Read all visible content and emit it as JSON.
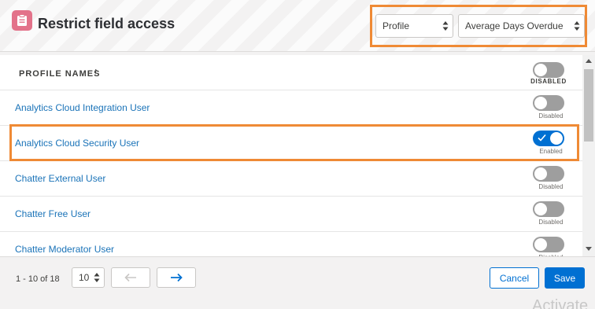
{
  "modal": {
    "title": "Restrict field access",
    "icon": "clipboard-icon"
  },
  "filters": {
    "profile_select": "Profile",
    "field_select": "Average Days Overdue"
  },
  "table": {
    "column_header": "PROFILE NAMES",
    "sort_indicator": "↑",
    "header_toggle_label": "DISABLED",
    "rows": [
      {
        "name": "Analytics Cloud Integration User",
        "state": "Disabled"
      },
      {
        "name": "Analytics Cloud Security User",
        "state": "Enabled"
      },
      {
        "name": "Chatter External User",
        "state": "Disabled"
      },
      {
        "name": "Chatter Free User",
        "state": "Disabled"
      },
      {
        "name": "Chatter Moderator User",
        "state": "Disabled"
      }
    ]
  },
  "footer": {
    "range": "1 - 10 of 18",
    "page_size": "10",
    "cancel_label": "Cancel",
    "save_label": "Save",
    "watermark": "Activate"
  },
  "colors": {
    "accent": "#0070d2",
    "highlight": "#ef8a35",
    "app_icon": "#e3728a",
    "link": "#1a73b8"
  }
}
